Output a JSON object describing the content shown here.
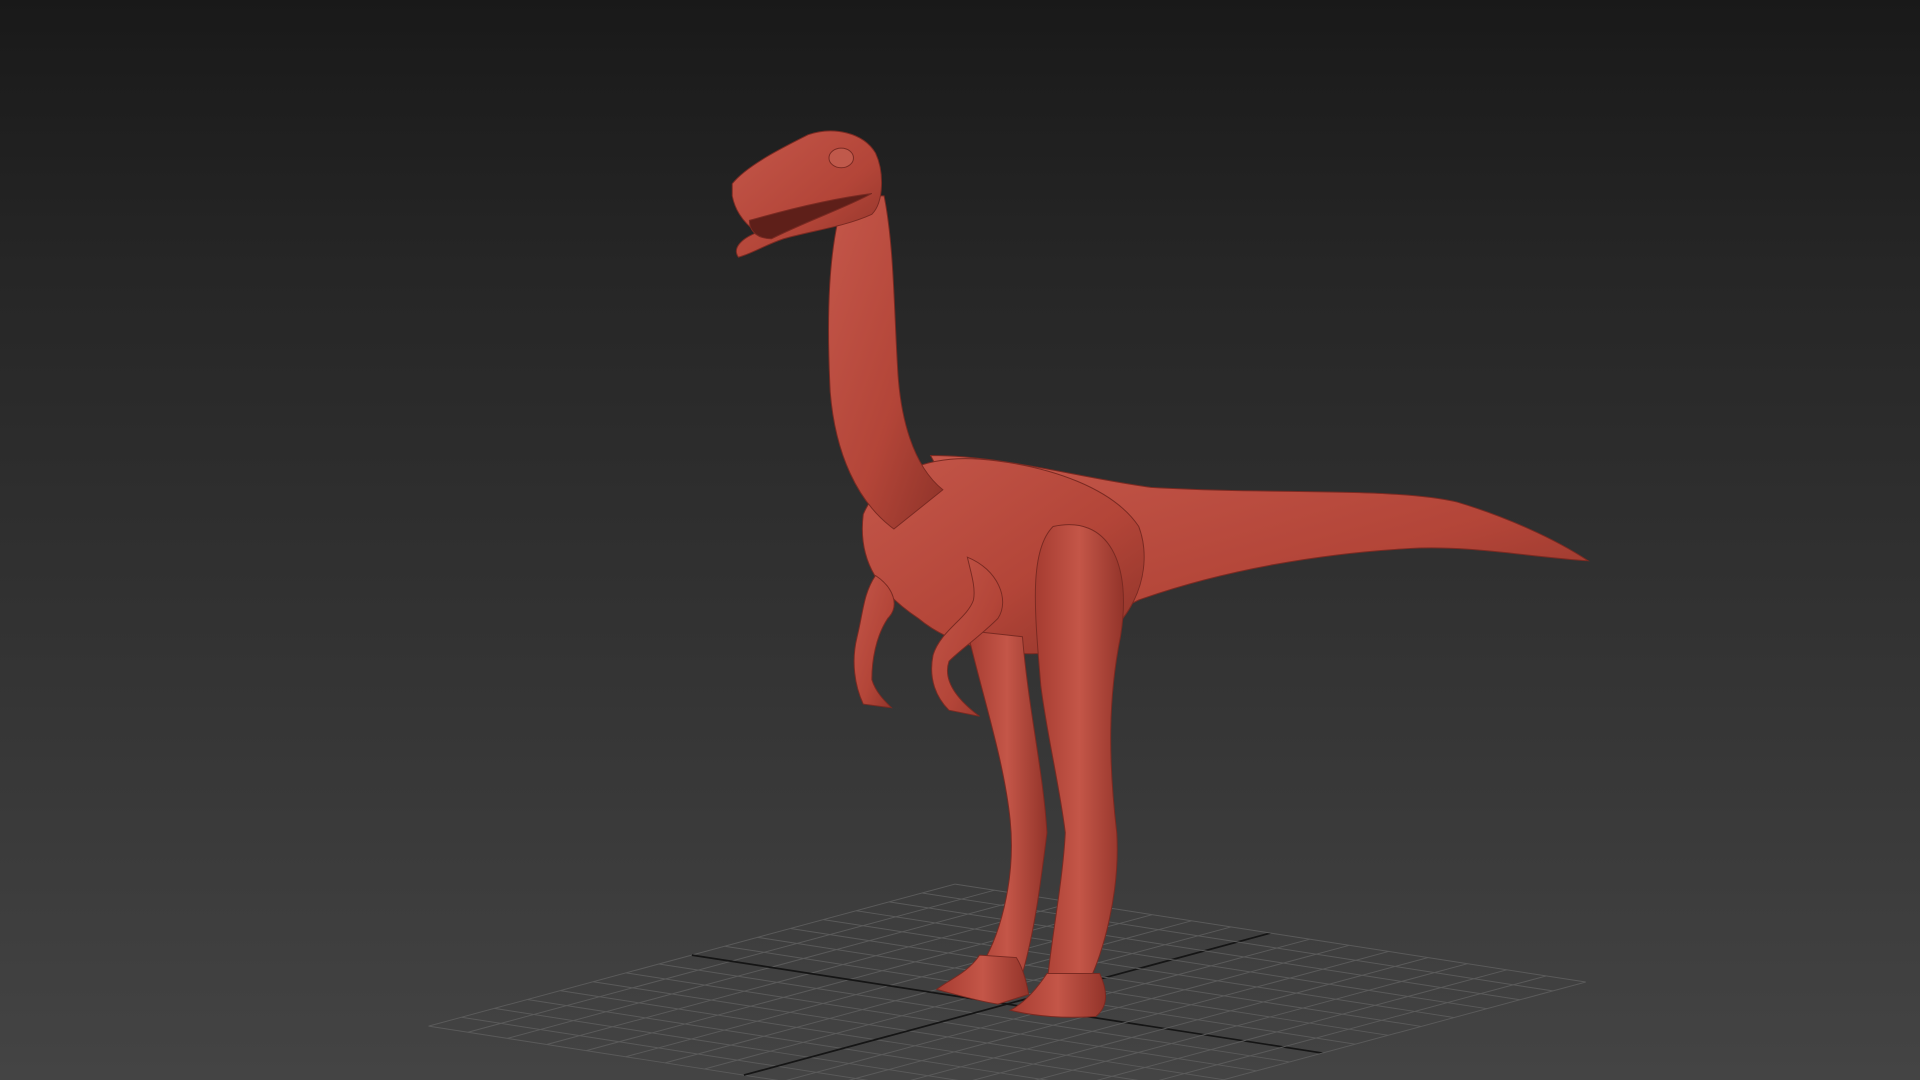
{
  "scene": {
    "model": "dinosaur",
    "colors": {
      "background_top": "#191919",
      "background_bottom": "#444444",
      "model_base": "#b84a3e",
      "model_shadow": "#8a3028",
      "model_highlight": "#d0685a",
      "grid_line": "#5a5a5a",
      "grid_axis": "#151515"
    },
    "grid_divisions": 16
  }
}
